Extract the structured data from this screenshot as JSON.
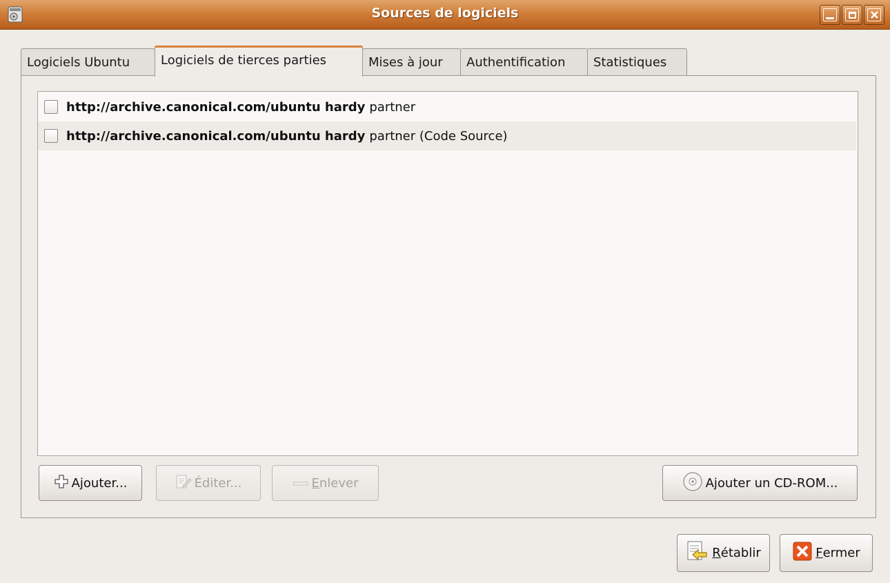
{
  "window": {
    "title": "Sources de logiciels",
    "controls": [
      "minimize-icon",
      "maximize-icon",
      "close-icon"
    ]
  },
  "tabs": [
    {
      "label": "Logiciels Ubuntu",
      "active": false
    },
    {
      "label": "Logiciels de tierces parties",
      "active": true
    },
    {
      "label": "Mises à jour",
      "active": false
    },
    {
      "label": "Authentification",
      "active": false
    },
    {
      "label": "Statistiques",
      "active": false
    }
  ],
  "sources": [
    {
      "checked": false,
      "url": "http://archive.canonical.com/ubuntu hardy",
      "suffix": "partner"
    },
    {
      "checked": false,
      "url": "http://archive.canonical.com/ubuntu hardy",
      "suffix": "partner (Code Source)"
    }
  ],
  "list_buttons": {
    "add": {
      "label": "Ajouter...",
      "icon": "plus-icon",
      "enabled": true
    },
    "edit": {
      "label": "Éditer...",
      "icon": "edit-icon",
      "enabled": false
    },
    "remove": {
      "label_rest": "nlever",
      "mnemonic": "E",
      "icon": "minus-icon",
      "enabled": false
    },
    "add_cdrom": {
      "label": "Ajouter un CD-ROM...",
      "icon": "cdrom-icon",
      "enabled": true
    }
  },
  "dialog_buttons": {
    "revert": {
      "mnemonic": "R",
      "label_rest": "établir",
      "icon": "revert-icon"
    },
    "close": {
      "mnemonic": "F",
      "label_rest": "ermer",
      "icon": "close-red-icon"
    }
  },
  "colors": {
    "titlebar": "#d27f3a",
    "active_tab_accent": "#d9823a",
    "close_icon": "#e8541c"
  }
}
